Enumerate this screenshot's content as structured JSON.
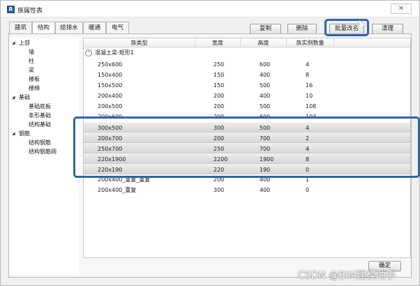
{
  "window": {
    "title": "族属性表",
    "app_icon_letter": "R",
    "close_glyph": "✕"
  },
  "tabs": [
    {
      "label": "建筑"
    },
    {
      "label": "结构",
      "active": true
    },
    {
      "label": "给排水"
    },
    {
      "label": "暖通"
    },
    {
      "label": "电气"
    }
  ],
  "toolbar": {
    "copy_label": "复制",
    "delete_label": "删除",
    "batch_label": "批量改名",
    "clear_label": "清理"
  },
  "tree": {
    "items": [
      {
        "label": "上部",
        "expanded": true
      },
      {
        "label": "墙"
      },
      {
        "label": "柱"
      },
      {
        "label": "梁"
      },
      {
        "label": "楼板"
      },
      {
        "label": "楼梯"
      },
      {
        "label": "基础",
        "expanded": true
      },
      {
        "label": "基础底板"
      },
      {
        "label": "条形基础"
      },
      {
        "label": "结构基础"
      },
      {
        "label": "钢筋",
        "expanded": true
      },
      {
        "label": "结构钢筋"
      },
      {
        "label": "结构钢筋网"
      }
    ]
  },
  "table": {
    "columns": [
      "族类型",
      "宽度",
      "高度",
      "族实例数量"
    ],
    "group": {
      "label": "混凝土梁-矩形1"
    },
    "rows": [
      {
        "type": "250x600",
        "width": "250",
        "height": "600",
        "count": "4",
        "selected": false
      },
      {
        "type": "150x400",
        "width": "150",
        "height": "400",
        "count": "8",
        "selected": false
      },
      {
        "type": "150x500",
        "width": "150",
        "height": "500",
        "count": "16",
        "selected": false
      },
      {
        "type": "200x400",
        "width": "200",
        "height": "400",
        "count": "10",
        "selected": false
      },
      {
        "type": "200x500",
        "width": "200",
        "height": "500",
        "count": "108",
        "selected": false
      },
      {
        "type": "200x600",
        "width": "200",
        "height": "600",
        "count": "103",
        "selected": false
      },
      {
        "type": "300x500",
        "width": "300",
        "height": "500",
        "count": "4",
        "selected": true
      },
      {
        "type": "200x700",
        "width": "200",
        "height": "700",
        "count": "2",
        "selected": true
      },
      {
        "type": "250x700",
        "width": "250",
        "height": "700",
        "count": "4",
        "selected": true
      },
      {
        "type": "220x1900",
        "width": "2200",
        "height": "1900",
        "count": "8",
        "selected": true
      },
      {
        "type": "220x190",
        "width": "220",
        "height": "190",
        "count": "0",
        "selected": true
      },
      {
        "type": "200x400_重复_重复",
        "width": "200",
        "height": "400",
        "count": "1",
        "selected": false
      },
      {
        "type": "200x400_重复",
        "width": "300",
        "height": "400",
        "count": "0",
        "selected": false
      }
    ]
  },
  "footer": {
    "ok_label": "确定"
  },
  "watermark": "CSDN @BIM建模助手",
  "colors": {
    "highlight": "#2e66a9",
    "accent_icon": "#1f4e94"
  }
}
